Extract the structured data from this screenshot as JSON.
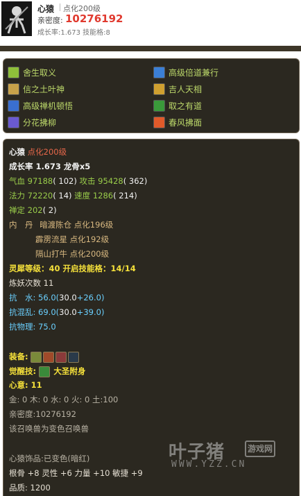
{
  "header": {
    "name": "心猿",
    "level": "点化200级",
    "intimacy_label": "亲密度:",
    "intimacy_value": "10276192",
    "growth_text": "成长率:1.673  技能格:8"
  },
  "skills": [
    {
      "label": "舍生取义",
      "icon": "sword-skill-icon",
      "color": "#8fbf3a"
    },
    {
      "label": "高级倍道兼行",
      "icon": "wind-skill-icon",
      "color": "#3b7fd6"
    },
    {
      "label": "信之土叶神",
      "icon": "earth-spirit-icon",
      "color": "#c8a24a"
    },
    {
      "label": "吉人天相",
      "icon": "fortune-skill-icon",
      "color": "#d0a030"
    },
    {
      "label": "高级禅机顿悟",
      "icon": "zen-skill-icon",
      "color": "#3a6fd0"
    },
    {
      "label": "取之有道",
      "icon": "path-skill-icon",
      "color": "#3a9a3a"
    },
    {
      "label": "分花拂柳",
      "icon": "flower-skill-icon",
      "color": "#6a5ad0"
    },
    {
      "label": "春风拂面",
      "icon": "fire-skill-icon",
      "color": "#e05a2a"
    }
  ],
  "info": {
    "name": "心猿",
    "level": " 点化200级",
    "growth": "成长率 1.673 龙骨x5",
    "hp_label": "气血 ",
    "hp_value": "97188",
    "hp_extra": "( 102)",
    "atk_label": " 攻击 ",
    "atk_value": "95428",
    "atk_extra": "( 362)",
    "mp_label": "法力 ",
    "mp_value": "72220",
    "mp_extra": "( 14)",
    "spd_label": " 速度 ",
    "spd_value": "1286",
    "spd_extra": "( 214)",
    "zen_label": "禅定 ",
    "zen_value": "202",
    "zen_extra": "( 2)",
    "neidan_label": "内　丹",
    "neidan_1": "暗渡陈仓 点化196级",
    "neidan_2": "霹雳流星 点化192级",
    "neidan_3": "隔山打牛 点化200级",
    "soul_level": "灵犀等级：40 开启技能格：14/14",
    "demon_count": "炼妖次数 11",
    "resist_water_label": "抗　水: ",
    "resist_water_a": "56.0(",
    "resist_water_b": "30.0",
    "resist_water_c": "+26.0)",
    "resist_chaos_label": "抗混乱: ",
    "resist_chaos_a": "69.0(",
    "resist_chaos_b": "30.0",
    "resist_chaos_c": "+39.0)",
    "resist_phys": "抗物理: 75.0",
    "equip_label": "装备:",
    "awaken_label": "觉醒技:",
    "awaken_skill": "大圣附身",
    "heart_label": "心意: 11",
    "elements": "金: 0 木: 0 水: 0 火: 0 土:100",
    "intimacy": "亲密度:10276192",
    "transform_note": "该召唤兽为变色召唤兽",
    "ornament": "心猿饰品:已变色(暗红)",
    "bonus": "根骨 +8 灵性 +6 力量 +10 敏捷 +9",
    "quality": "品质: 1200"
  },
  "equipment": [
    {
      "icon": "ring-equip-icon",
      "color": "#7a8a3a"
    },
    {
      "icon": "claw-equip-icon",
      "color": "#a04a2a"
    },
    {
      "icon": "armor-equip-icon",
      "color": "#8a3a3a"
    },
    {
      "icon": "crescent-equip-icon",
      "color": "#2a3a4a"
    }
  ],
  "watermark": {
    "main": "叶子猪",
    "box": "游戏网",
    "url": "WWW.YZZ.CN"
  }
}
